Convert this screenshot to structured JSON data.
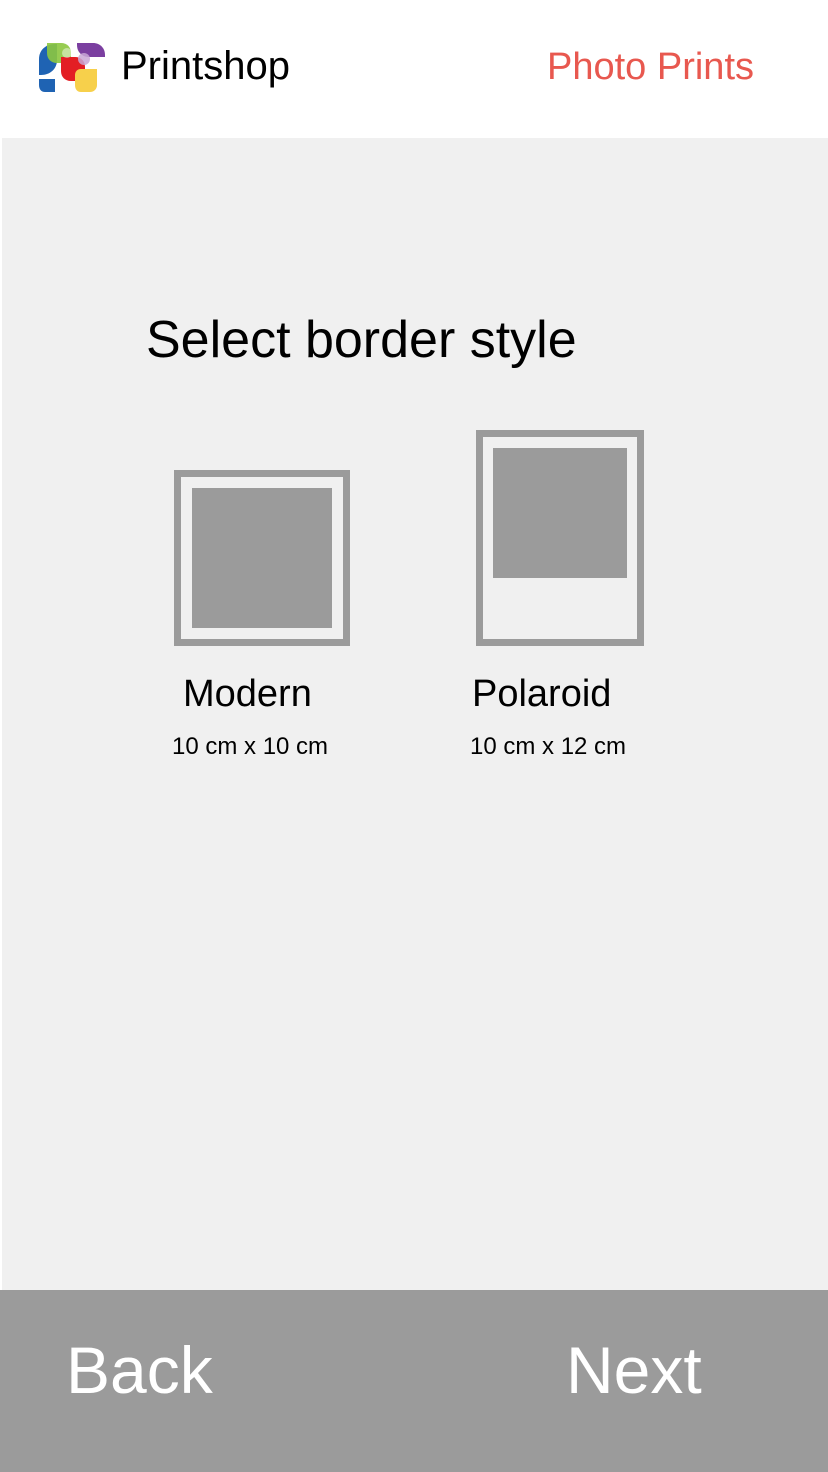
{
  "header": {
    "app_name": "Printshop",
    "logo_icon": "printshop-logo-icon",
    "section_link": "Photo Prints"
  },
  "main": {
    "title": "Select border style",
    "options": [
      {
        "name": "Modern",
        "size": "10 cm x 10 cm",
        "icon": "modern-border-thumbnail"
      },
      {
        "name": "Polaroid",
        "size": "10 cm x 12 cm",
        "icon": "polaroid-border-thumbnail"
      }
    ]
  },
  "footer": {
    "back_label": "Back",
    "next_label": "Next"
  },
  "colors": {
    "accent": "#e8584f",
    "footer_bg": "#9b9b9b",
    "content_bg": "#f0f0f0",
    "thumbnail": "#9b9b9b"
  }
}
